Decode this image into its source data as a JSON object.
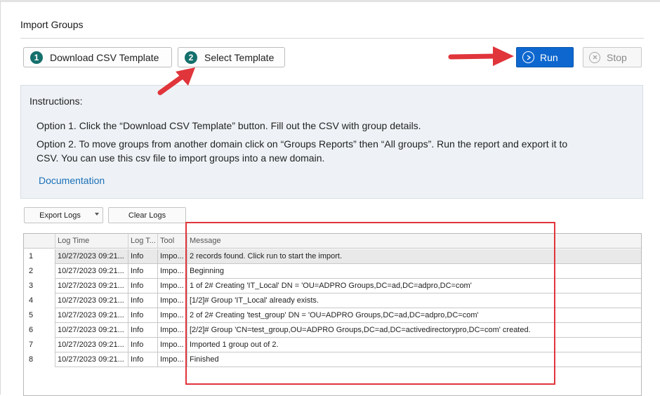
{
  "page": {
    "title": "Import Groups"
  },
  "toolbar": {
    "download": {
      "step": "1",
      "label": "Download CSV Template"
    },
    "select": {
      "step": "2",
      "label": "Select Template"
    },
    "run_label": "Run",
    "stop_label": "Stop",
    "run_icon": "play-circle-icon",
    "stop_icon": "close-circle-icon"
  },
  "instructions": {
    "heading": "Instructions:",
    "option1": "Option 1. Click the “Download CSV Template” button. Fill out the CSV with group details.",
    "option2": "Option 2. To move groups from another domain click on “Groups Reports” then “All groups”. Run the report and export it to CSV. You can use this csv file to import groups into a new domain.",
    "documentation_link": "Documentation"
  },
  "log_buttons": {
    "export": "Export Logs",
    "clear": "Clear Logs"
  },
  "log_table": {
    "columns": [
      "Log Time",
      "Log T...",
      "Tool",
      "Message"
    ],
    "rows": [
      {
        "num": "1",
        "time": "10/27/2023 09:21...",
        "type": "Info",
        "tool": "Impo...",
        "message": "2 records found. Click run to start the import."
      },
      {
        "num": "2",
        "time": "10/27/2023 09:21...",
        "type": "Info",
        "tool": "Impo...",
        "message": "Beginning"
      },
      {
        "num": "3",
        "time": "10/27/2023 09:21...",
        "type": "Info",
        "tool": "Impo...",
        "message": "1 of 2# Creating 'IT_Local' DN = 'OU=ADPRO Groups,DC=ad,DC=adpro,DC=com'"
      },
      {
        "num": "4",
        "time": "10/27/2023 09:21...",
        "type": "Info",
        "tool": "Impo...",
        "message": "[1/2]# Group 'IT_Local' already exists."
      },
      {
        "num": "5",
        "time": "10/27/2023 09:21...",
        "type": "Info",
        "tool": "Impo...",
        "message": "2 of 2# Creating 'test_group' DN = 'OU=ADPRO Groups,DC=ad,DC=adpro,DC=com'"
      },
      {
        "num": "6",
        "time": "10/27/2023 09:21...",
        "type": "Info",
        "tool": "Impo...",
        "message": "[2/2]# Group 'CN=test_group,OU=ADPRO Groups,DC=ad,DC=activedirectorypro,DC=com' created."
      },
      {
        "num": "7",
        "time": "10/27/2023 09:21...",
        "type": "Info",
        "tool": "Impo...",
        "message": "Imported 1 group out of 2."
      },
      {
        "num": "8",
        "time": "10/27/2023 09:21...",
        "type": "Info",
        "tool": "Impo...",
        "message": "Finished"
      }
    ]
  },
  "colors": {
    "accent": "#0d67cf",
    "step_badge": "#15706c",
    "annotation_red": "#e0353b",
    "link": "#1a6fb7"
  }
}
